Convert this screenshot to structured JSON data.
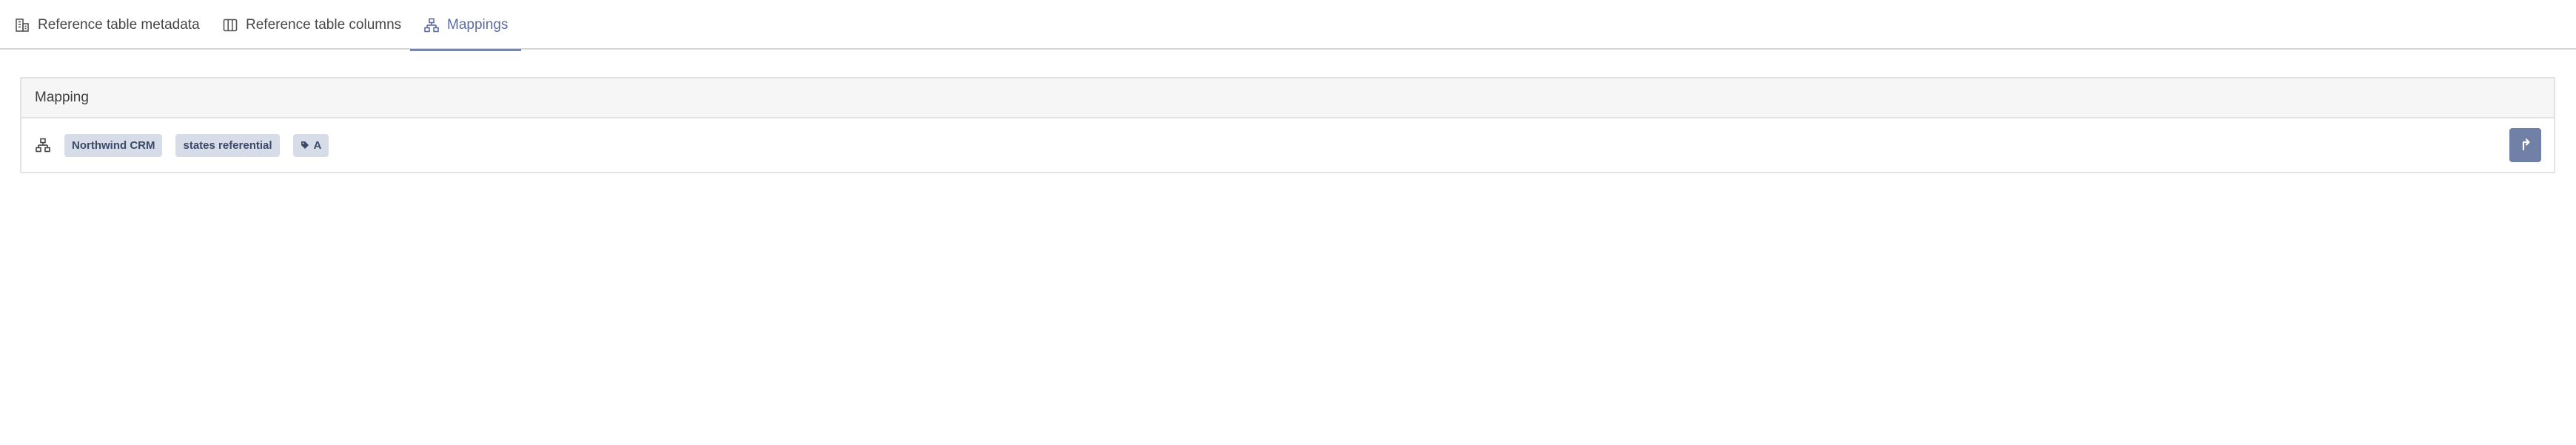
{
  "tabs": [
    {
      "label": "Reference table metadata",
      "icon": "building-icon",
      "active": false
    },
    {
      "label": "Reference table columns",
      "icon": "columns-icon",
      "active": false
    },
    {
      "label": "Mappings",
      "icon": "sitemap-icon",
      "active": true
    }
  ],
  "panel": {
    "header": "Mapping",
    "rows": [
      {
        "icon": "sitemap-icon",
        "badges": [
          "Northwind CRM",
          "states referential"
        ],
        "tag": "A",
        "action_icon": "external-link-icon"
      }
    ]
  },
  "colors": {
    "accent": "#5d6d9e",
    "badge_bg": "#d7dde8",
    "badge_text": "#3b4a68",
    "button_bg": "#7080a6"
  }
}
